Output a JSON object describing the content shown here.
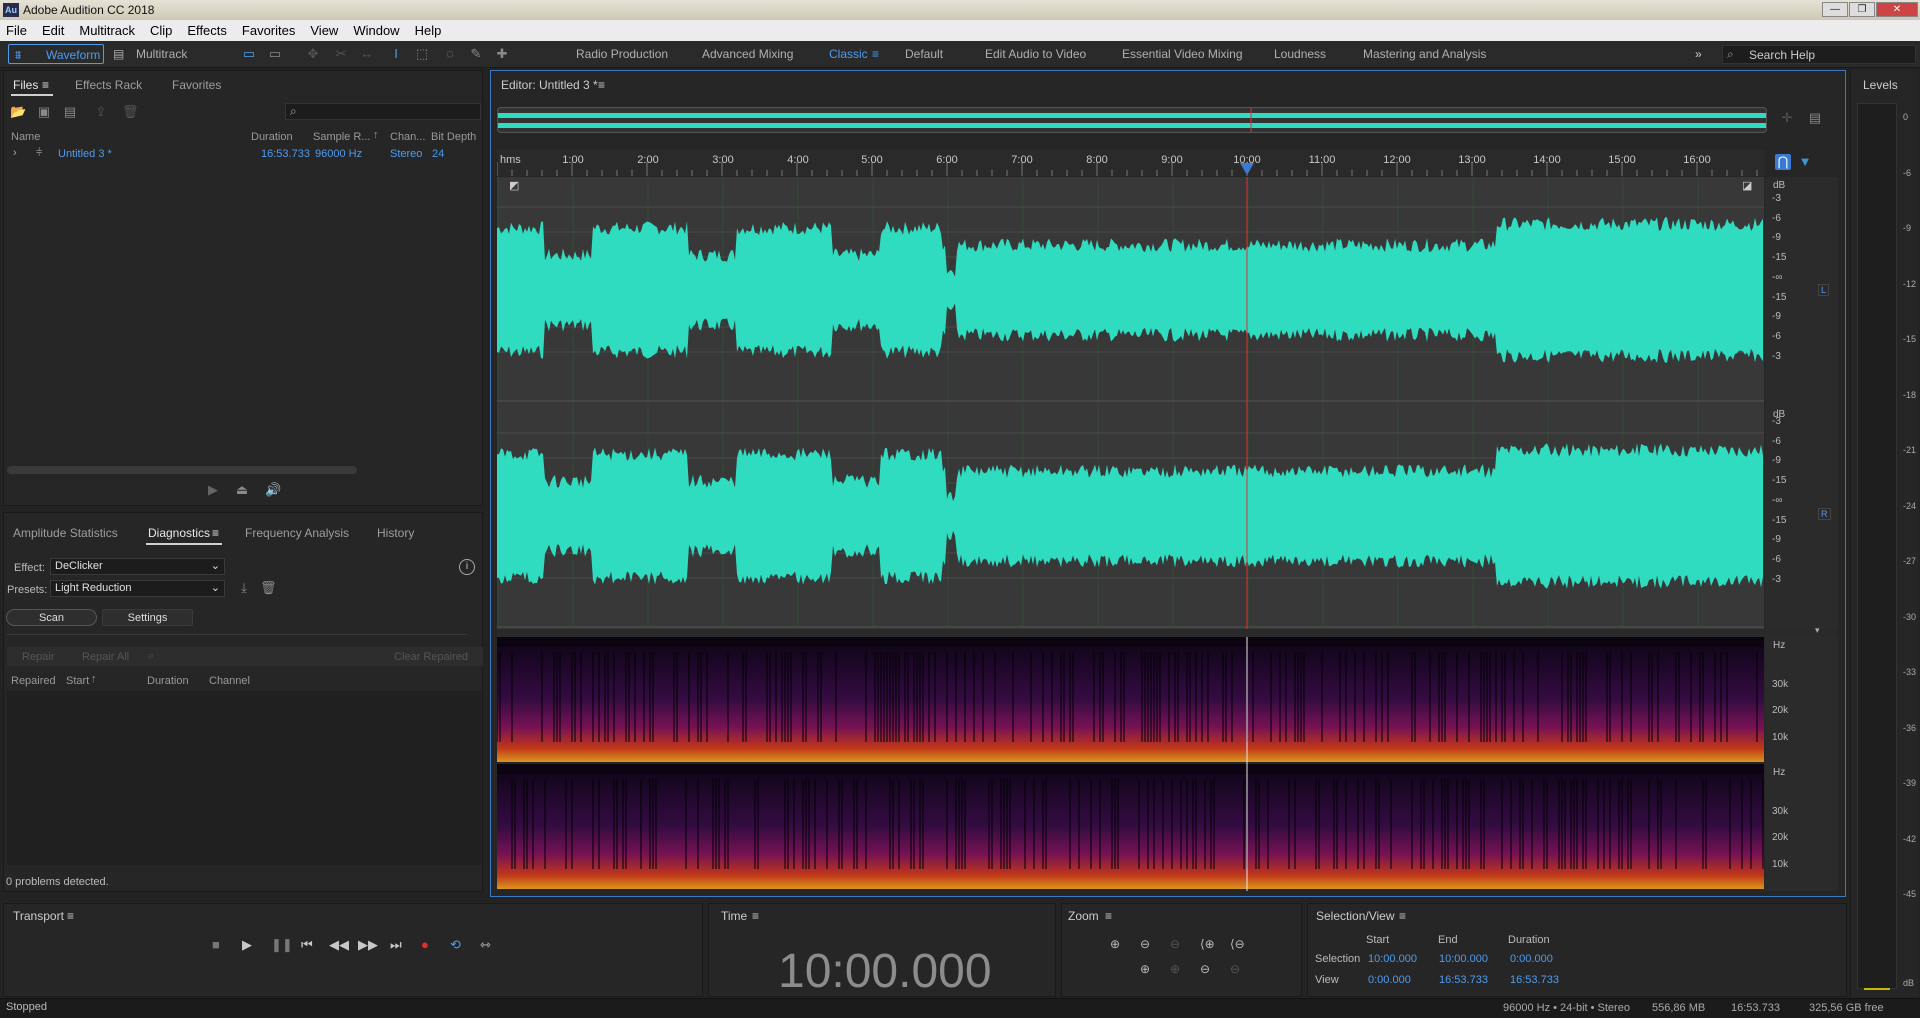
{
  "app": {
    "title": "Adobe Audition CC 2018",
    "icon": "Au"
  },
  "menu": [
    "File",
    "Edit",
    "Multitrack",
    "Clip",
    "Effects",
    "Favorites",
    "View",
    "Window",
    "Help"
  ],
  "toolbar": {
    "waveform_label": "Waveform",
    "multitrack_label": "Multitrack",
    "workspaces": [
      "Radio Production",
      "Advanced Mixing",
      "Classic",
      "Default",
      "Edit Audio to Video",
      "Essential Video Mixing",
      "Loudness",
      "Mastering and Analysis"
    ],
    "active_workspace": "Classic",
    "search_placeholder": "Search Help"
  },
  "files_panel": {
    "tabs": [
      "Files",
      "Effects Rack",
      "Favorites"
    ],
    "columns": {
      "name": "Name",
      "duration": "Duration",
      "sample_rate": "Sample R...",
      "channels": "Chan...",
      "bit_depth": "Bit Depth"
    },
    "rows": [
      {
        "name": "Untitled 3 *",
        "duration": "16:53.733",
        "sample_rate": "96000 Hz",
        "channels": "Stereo",
        "bit_depth": "24"
      }
    ]
  },
  "diag_panel": {
    "tabs": [
      "Amplitude Statistics",
      "Diagnostics",
      "Frequency Analysis",
      "History"
    ],
    "effect_label": "Effect:",
    "effect_value": "DeClicker",
    "presets_label": "Presets:",
    "presets_value": "Light Reduction",
    "scan_label": "Scan",
    "settings_label": "Settings",
    "repair_label": "Repair",
    "repair_all_label": "Repair All",
    "clear_repaired_label": "Clear Repaired",
    "columns": {
      "repaired": "Repaired",
      "start": "Start",
      "duration": "Duration",
      "channel": "Channel"
    },
    "status": "0 problems detected."
  },
  "editor": {
    "title": "Editor: Untitled 3 *",
    "ruler_unit": "hms",
    "ruler_ticks": [
      "1:00",
      "2:00",
      "3:00",
      "4:00",
      "5:00",
      "6:00",
      "7:00",
      "8:00",
      "9:00",
      "10:00",
      "11:00",
      "12:00",
      "13:00",
      "14:00",
      "15:00",
      "16:00"
    ],
    "db_label": "dB",
    "db_scale": [
      "-3",
      "-6",
      "-9",
      "-15",
      "-∞",
      "-15",
      "-9",
      "-6",
      "-3"
    ],
    "hz_label": "Hz",
    "hz_scale": [
      "30k",
      "20k",
      "10k"
    ],
    "channel_left": "L",
    "channel_right": "R",
    "colors": {
      "waveform": "#2fdcc0",
      "playhead": "#e03030",
      "accent": "#4e9cf0"
    }
  },
  "levels": {
    "title": "Levels",
    "scale": [
      "0",
      "-6",
      "-9",
      "-12",
      "-15",
      "-18",
      "-21",
      "-24",
      "-27",
      "-30",
      "-33",
      "-36",
      "-39",
      "-42",
      "-45"
    ],
    "db_label": "dB"
  },
  "transport": {
    "title": "Transport"
  },
  "time": {
    "title": "Time",
    "value": "10:00.000"
  },
  "zoom": {
    "title": "Zoom"
  },
  "selection_view": {
    "title": "Selection/View",
    "headers": {
      "start": "Start",
      "end": "End",
      "duration": "Duration"
    },
    "selection": {
      "label": "Selection",
      "start": "10:00.000",
      "end": "10:00.000",
      "duration": "0:00.000"
    },
    "view": {
      "label": "View",
      "start": "0:00.000",
      "end": "16:53.733",
      "duration": "16:53.733"
    }
  },
  "statusbar": {
    "left": "Stopped",
    "format": "96000 Hz • 24-bit • Stereo",
    "size": "556,86 MB",
    "duration": "16:53.733",
    "free": "325,56 GB free"
  }
}
